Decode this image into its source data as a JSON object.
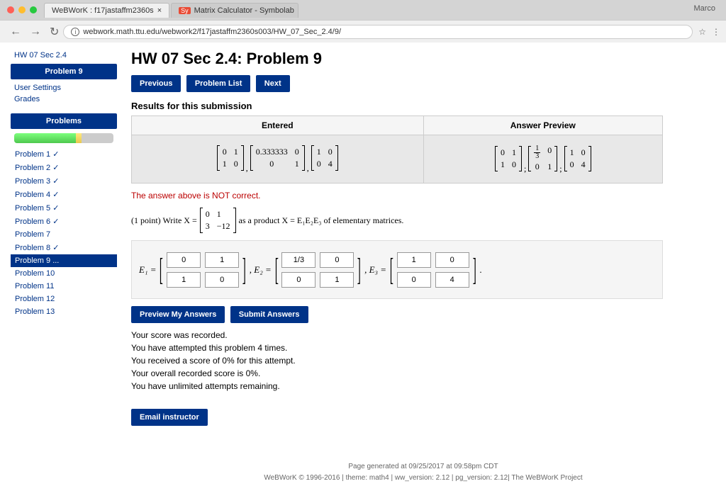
{
  "browser": {
    "profile": "Marco",
    "tab1": "WeBWorK : f17jastaffm2360s",
    "tab2": "Matrix Calculator - Symbolab",
    "url": "webwork.math.ttu.edu/webwork2/f17jastaffm2360s003/HW_07_Sec_2.4/9/"
  },
  "sidebar": {
    "hw": "HW 07 Sec 2.4",
    "problem": "Problem 9",
    "settings": "User Settings",
    "grades": "Grades",
    "problems_hdr": "Problems",
    "items": [
      "Problem 1 ✓",
      "Problem 2 ✓",
      "Problem 3 ✓",
      "Problem 4 ✓",
      "Problem 5 ✓",
      "Problem 6 ✓",
      "Problem 7",
      "Problem 8 ✓",
      "Problem 9 ...",
      "Problem 10",
      "Problem 11",
      "Problem 12",
      "Problem 13"
    ]
  },
  "content": {
    "title": "HW 07 Sec 2.4: Problem 9",
    "nav": {
      "prev": "Previous",
      "list": "Problem List",
      "next": "Next"
    },
    "results_title": "Results for this submission",
    "th_entered": "Entered",
    "th_preview": "Answer Preview",
    "entered_cell": "[0 1; 1 0] , [0.333333 0; 0 1] , [1 0; 0 4]",
    "preview_cell": "[0 1; 1 0] ; [1/3 0; 0 1] ; [1 0; 0 4]",
    "error": "The answer above is NOT correct.",
    "points": "(1 point) Write X = ",
    "matrix_text": " as a product X = E₁E₂E₃ of elementary matrices.",
    "E1": "E₁ = ",
    "E2": ", E₂ = ",
    "E3": ", E₃ = ",
    "inputs": {
      "e1": [
        "0",
        "1",
        "1",
        "0"
      ],
      "e2": [
        "1/3",
        "0",
        "0",
        "1"
      ],
      "e3": [
        "1",
        "0",
        "0",
        "4"
      ]
    },
    "preview_btn": "Preview My Answers",
    "submit_btn": "Submit Answers",
    "score": [
      "Your score was recorded.",
      "You have attempted this problem 4 times.",
      "You received a score of 0% for this attempt.",
      "Your overall recorded score is 0%.",
      "You have unlimited attempts remaining."
    ],
    "email_btn": "Email instructor"
  },
  "footer": {
    "l1": "Page generated at 09/25/2017 at 09:58pm CDT",
    "l2": "WeBWorK © 1996-2016 | theme: math4 | ww_version: 2.12 | pg_version: 2.12| The WeBWorK Project"
  }
}
